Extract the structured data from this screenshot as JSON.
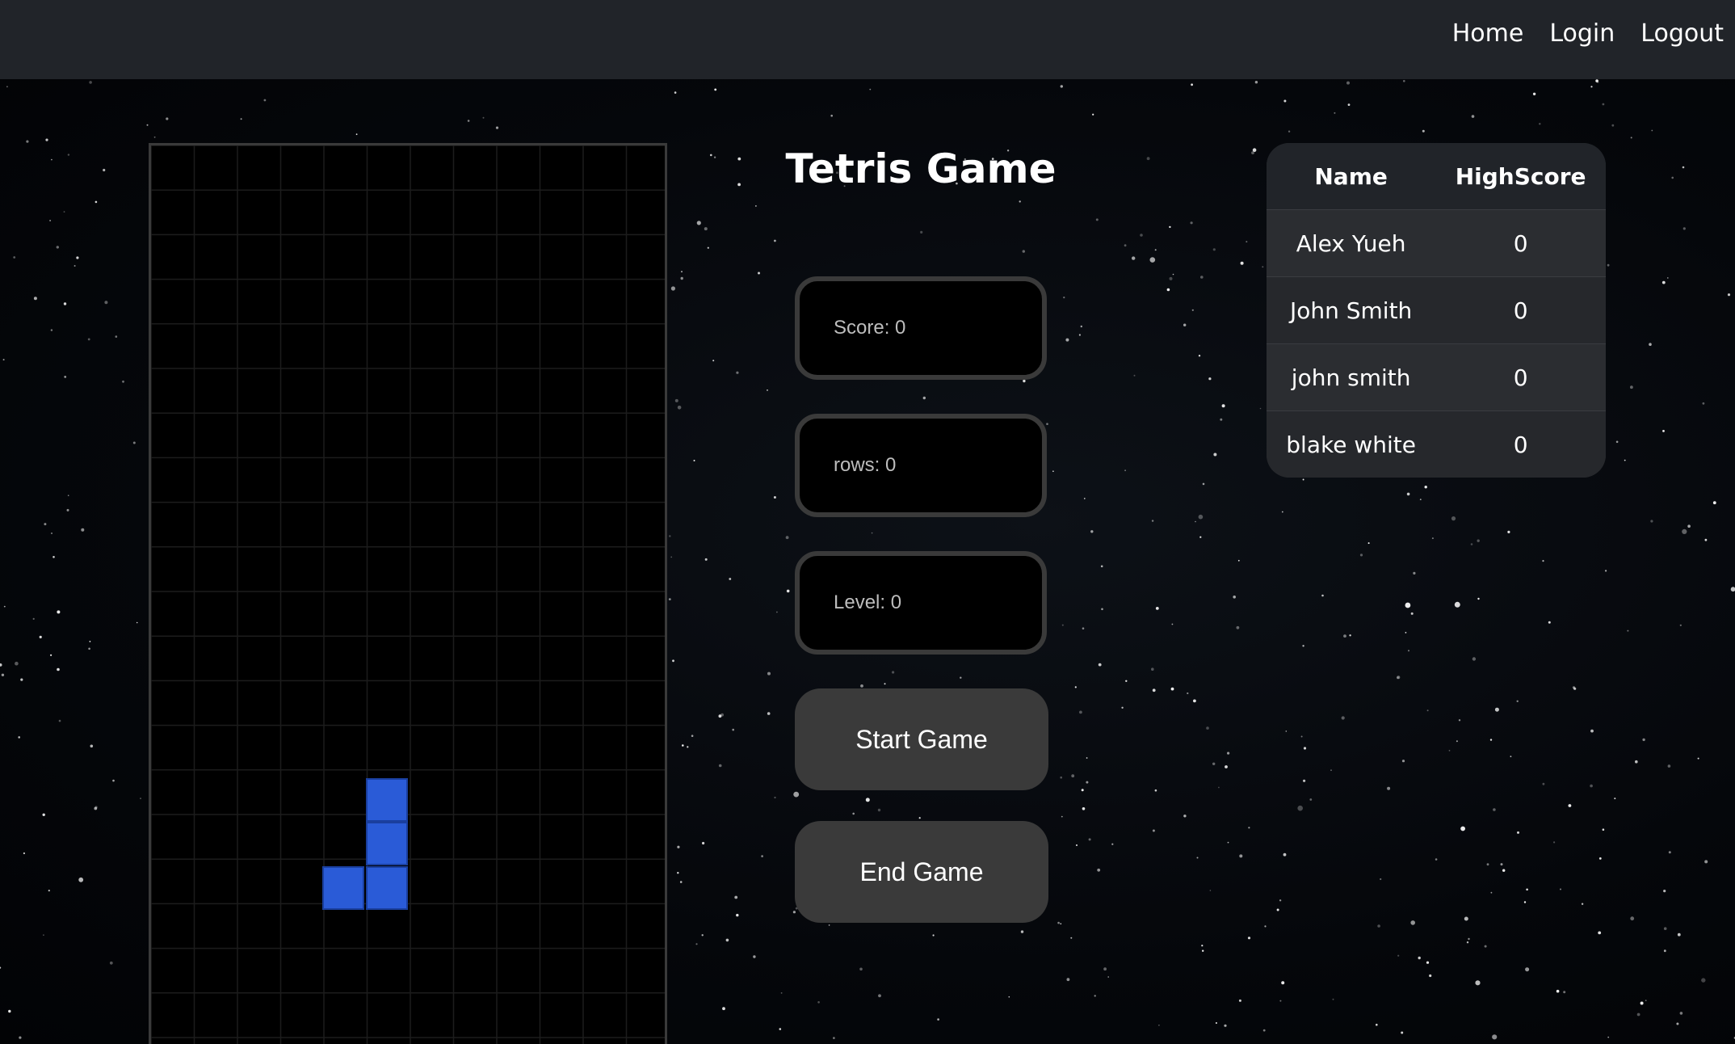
{
  "nav": {
    "links": [
      "Home",
      "Login",
      "Logout"
    ]
  },
  "game": {
    "title": "Tetris Game",
    "score_label": "Score: 0",
    "rows_label": "rows: 0",
    "level_label": "Level: 0",
    "start_label": "Start Game",
    "end_label": "End Game",
    "piece_color": "#2a5bd7"
  },
  "highscores": {
    "headers": [
      "Name",
      "HighScore"
    ],
    "rows": [
      {
        "name": "Alex Yueh",
        "score": "0"
      },
      {
        "name": "John Smith",
        "score": "0"
      },
      {
        "name": "john smith",
        "score": "0"
      },
      {
        "name": "blake white",
        "score": "0"
      }
    ]
  }
}
